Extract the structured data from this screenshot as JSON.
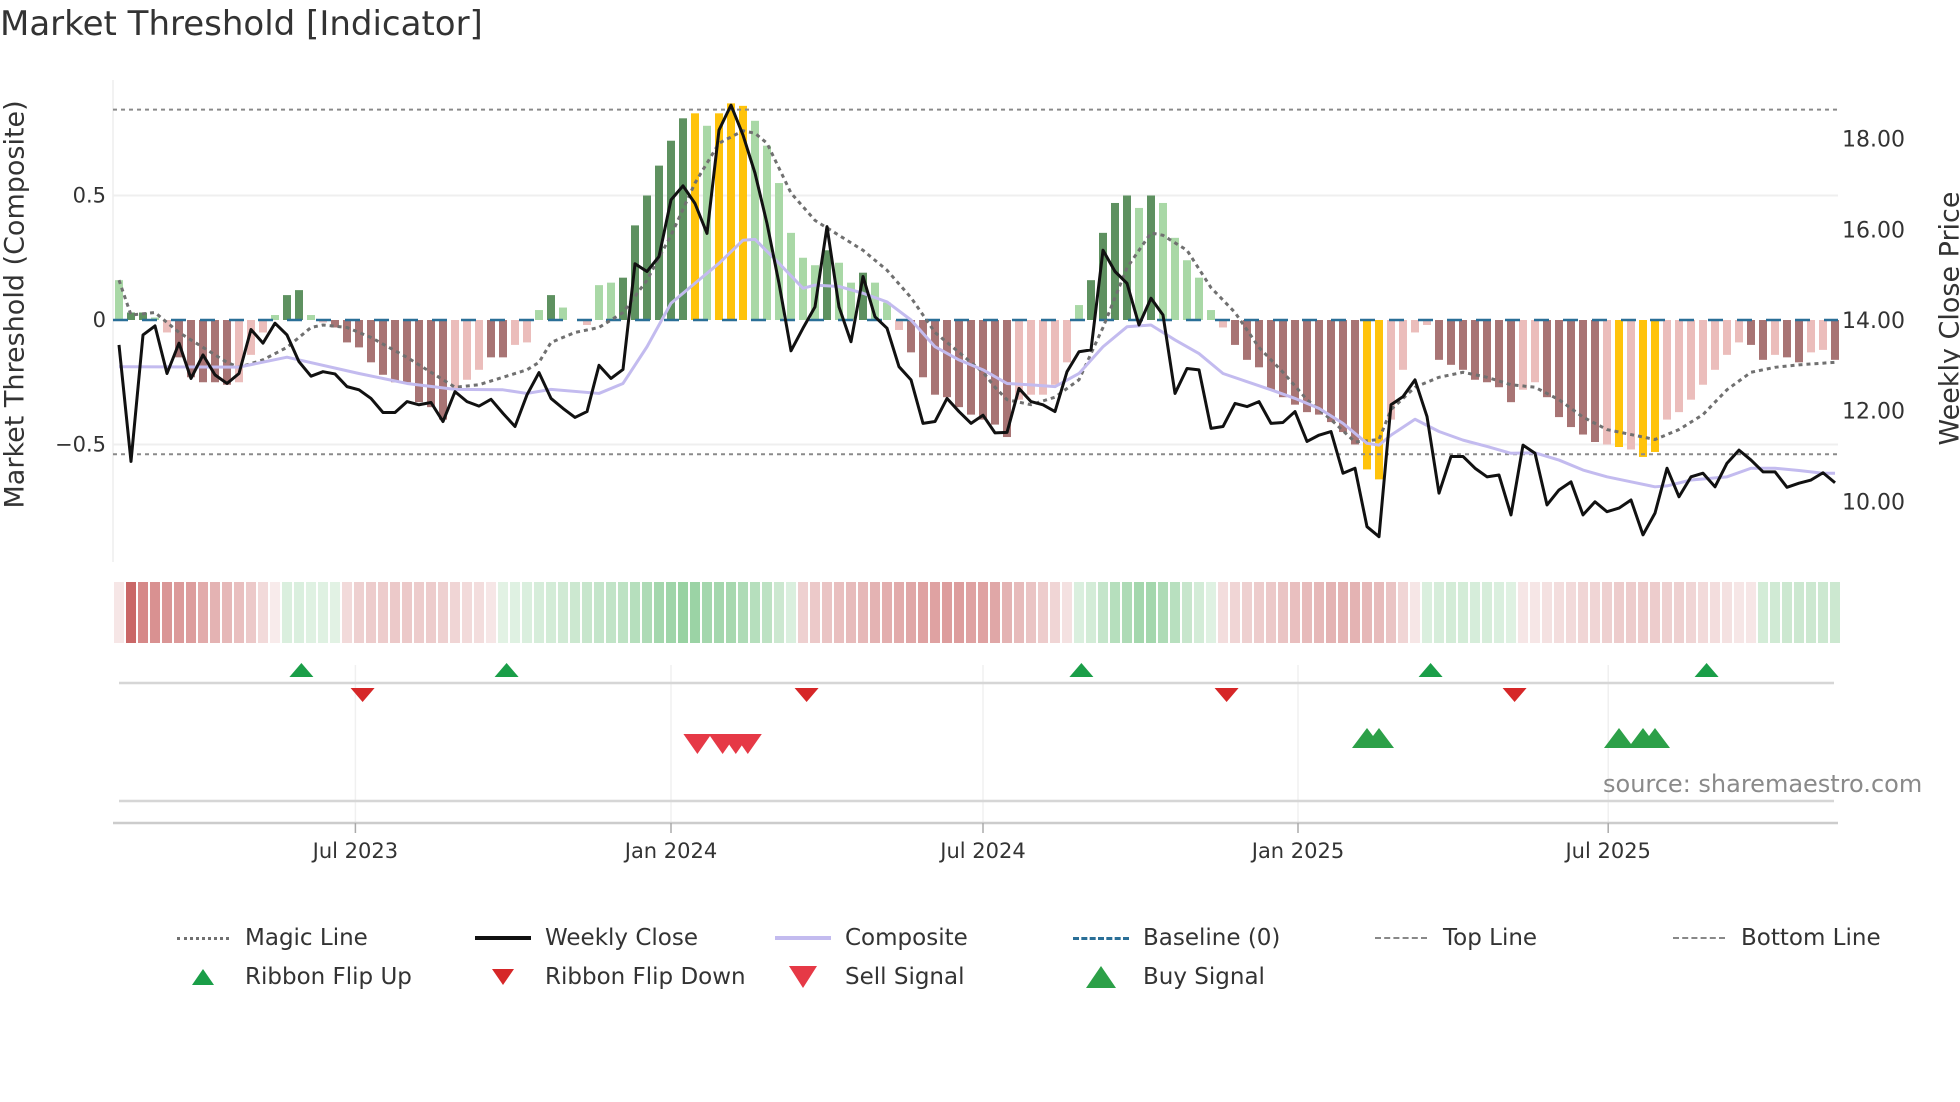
{
  "title": "Market Threshold [Indicator]",
  "source": "source: sharemaestro.com",
  "chart_data": {
    "type": "bar",
    "title": "Market Threshold [Indicator]",
    "ylabel_left": "Market Threshold (Composite)",
    "ylabel_right": "Weekly Close Price",
    "ylim_left": [
      -0.78,
      0.9
    ],
    "ylim_right": [
      8.75,
      19.5
    ],
    "left_ticks": [
      {
        "v": 0.5,
        "label": "0.5"
      },
      {
        "v": 0,
        "label": "0"
      },
      {
        "v": -0.5,
        "label": "−0.5"
      }
    ],
    "right_ticks": [
      {
        "v": 18,
        "label": "18.00"
      },
      {
        "v": 16,
        "label": "16.00"
      },
      {
        "v": 14,
        "label": "14.00"
      },
      {
        "v": 12,
        "label": "12.00"
      },
      {
        "v": 10,
        "label": "10.00"
      }
    ],
    "x_unit": "week index (weekly bars, ~Feb 2023 – Nov 2025)",
    "x_ticks": [
      {
        "week": 19.7,
        "label": "Jul 2023"
      },
      {
        "week": 46,
        "label": "Jan 2024"
      },
      {
        "week": 72,
        "label": "Jul 2024"
      },
      {
        "week": 98.25,
        "label": "Jan 2025"
      },
      {
        "week": 124.1,
        "label": "Jul 2025"
      }
    ],
    "top_line": 0.845,
    "bottom_line": -0.539,
    "baseline": 0,
    "colors": {
      "dg": "#5e9160",
      "lg": "#a9d8a6",
      "dr": "#a87474",
      "lr": "#ebbdbb",
      "y": "#ffc30b",
      "close": "#111111",
      "composite": "#c3bbef",
      "magic": "#707070",
      "baseline": "#2a6f97",
      "flip_up": "#1a9e48",
      "flip_down": "#d62728",
      "sell": "#e63946",
      "buy": "#2ca048"
    },
    "histogram": [
      0.16,
      0.03,
      0.03,
      0.01,
      -0.05,
      -0.15,
      -0.23,
      -0.25,
      -0.25,
      -0.26,
      -0.25,
      -0.14,
      -0.05,
      0.02,
      0.1,
      0.12,
      0.02,
      -0.01,
      -0.03,
      -0.09,
      -0.11,
      -0.17,
      -0.22,
      -0.25,
      -0.25,
      -0.33,
      -0.35,
      -0.4,
      -0.28,
      -0.24,
      -0.2,
      -0.15,
      -0.15,
      -0.1,
      -0.09,
      0.04,
      0.1,
      0.05,
      0.0,
      -0.02,
      0.14,
      0.15,
      0.17,
      0.38,
      0.5,
      0.62,
      0.72,
      0.81,
      0.83,
      0.78,
      0.83,
      0.87,
      0.86,
      0.8,
      0.7,
      0.55,
      0.35,
      0.25,
      0.22,
      0.28,
      0.23,
      0.15,
      0.19,
      0.15,
      0.07,
      -0.04,
      -0.13,
      -0.23,
      -0.3,
      -0.31,
      -0.35,
      -0.38,
      -0.4,
      -0.42,
      -0.47,
      -0.32,
      -0.3,
      -0.3,
      -0.26,
      -0.17,
      0.06,
      0.16,
      0.35,
      0.47,
      0.5,
      0.45,
      0.5,
      0.47,
      0.33,
      0.24,
      0.17,
      0.04,
      -0.03,
      -0.1,
      -0.16,
      -0.19,
      -0.28,
      -0.31,
      -0.34,
      -0.37,
      -0.38,
      -0.41,
      -0.45,
      -0.5,
      -0.6,
      -0.64,
      -0.4,
      -0.2,
      -0.05,
      -0.02,
      -0.16,
      -0.18,
      -0.2,
      -0.24,
      -0.25,
      -0.27,
      -0.33,
      -0.28,
      -0.25,
      -0.31,
      -0.39,
      -0.43,
      -0.46,
      -0.49,
      -0.5,
      -0.51,
      -0.52,
      -0.55,
      -0.53,
      -0.4,
      -0.37,
      -0.32,
      -0.26,
      -0.2,
      -0.14,
      -0.09,
      -0.1,
      -0.16,
      -0.14,
      -0.15,
      -0.17,
      -0.13,
      -0.12,
      -0.16
    ],
    "histogram_color": [
      "lg",
      "dg",
      "dg",
      "lg",
      "lr",
      "dr",
      "dr",
      "dr",
      "dr",
      "dr",
      "lr",
      "lr",
      "lr",
      "lg",
      "dg",
      "dg",
      "lg",
      "lr",
      "dr",
      "dr",
      "dr",
      "dr",
      "dr",
      "dr",
      "dr",
      "dr",
      "dr",
      "dr",
      "lr",
      "lr",
      "lr",
      "dr",
      "dr",
      "lr",
      "lr",
      "lg",
      "dg",
      "lg",
      "lg",
      "lr",
      "lg",
      "lg",
      "dg",
      "dg",
      "dg",
      "dg",
      "dg",
      "dg",
      "y",
      "lg",
      "y",
      "y",
      "y",
      "lg",
      "lg",
      "lg",
      "lg",
      "lg",
      "lg",
      "dg",
      "lg",
      "lg",
      "dg",
      "lg",
      "lg",
      "lr",
      "dr",
      "dr",
      "dr",
      "dr",
      "dr",
      "dr",
      "dr",
      "dr",
      "dr",
      "lr",
      "lr",
      "lr",
      "lr",
      "lr",
      "lg",
      "dg",
      "dg",
      "dg",
      "dg",
      "lg",
      "dg",
      "lg",
      "lg",
      "lg",
      "lg",
      "lg",
      "lr",
      "dr",
      "dr",
      "dr",
      "dr",
      "dr",
      "dr",
      "dr",
      "dr",
      "dr",
      "dr",
      "dr",
      "y",
      "y",
      "lr",
      "lr",
      "lr",
      "lr",
      "dr",
      "dr",
      "dr",
      "dr",
      "dr",
      "dr",
      "dr",
      "lr",
      "lr",
      "dr",
      "dr",
      "dr",
      "dr",
      "dr",
      "lr",
      "y",
      "lr",
      "y",
      "y",
      "lr",
      "lr",
      "lr",
      "lr",
      "lr",
      "lr",
      "lr",
      "dr",
      "dr",
      "lr",
      "dr",
      "dr",
      "lr",
      "lr",
      "dr"
    ],
    "weekly_close": [
      13.45,
      10.88,
      13.67,
      13.87,
      12.82,
      13.49,
      12.71,
      13.23,
      12.79,
      12.6,
      12.82,
      13.79,
      13.49,
      13.93,
      13.67,
      13.08,
      12.76,
      12.86,
      12.81,
      12.53,
      12.46,
      12.27,
      11.96,
      11.96,
      12.2,
      12.13,
      12.18,
      11.76,
      12.42,
      12.2,
      12.1,
      12.25,
      11.94,
      11.65,
      12.35,
      12.84,
      12.27,
      12.05,
      11.85,
      11.98,
      13.0,
      12.71,
      12.91,
      15.24,
      15.07,
      15.4,
      16.65,
      16.96,
      16.57,
      15.91,
      18.19,
      18.74,
      18.08,
      17.24,
      16.13,
      14.81,
      13.32,
      13.82,
      14.29,
      16.06,
      14.29,
      13.52,
      14.96,
      14.07,
      13.82,
      12.97,
      12.68,
      11.72,
      11.76,
      12.27,
      11.98,
      11.72,
      11.9,
      11.51,
      11.52,
      12.49,
      12.2,
      12.13,
      11.98,
      12.86,
      13.3,
      13.34,
      15.54,
      15.07,
      14.81,
      13.89,
      14.48,
      14.11,
      12.38,
      12.93,
      12.9,
      11.61,
      11.65,
      12.16,
      12.09,
      12.2,
      11.72,
      11.74,
      11.98,
      11.32,
      11.46,
      11.54,
      10.62,
      10.73,
      9.44,
      9.22,
      12.13,
      12.31,
      12.68,
      11.87,
      10.18,
      10.99,
      10.99,
      10.73,
      10.54,
      10.58,
      9.7,
      11.24,
      11.06,
      9.92,
      10.25,
      10.43,
      9.7,
      9.99,
      9.77,
      9.85,
      10.03,
      9.26,
      9.74,
      10.73,
      10.1,
      10.54,
      10.62,
      10.32,
      10.84,
      11.13,
      10.91,
      10.65,
      10.65,
      10.31,
      10.4,
      10.47,
      10.63,
      10.41
    ],
    "composite": [
      [
        0,
        12.97
      ],
      [
        10,
        12.96
      ],
      [
        14,
        13.18
      ],
      [
        20,
        12.82
      ],
      [
        24,
        12.6
      ],
      [
        28,
        12.47
      ],
      [
        32,
        12.46
      ],
      [
        34,
        12.38
      ],
      [
        36,
        12.47
      ],
      [
        40,
        12.38
      ],
      [
        42,
        12.6
      ],
      [
        44,
        13.41
      ],
      [
        46,
        14.37
      ],
      [
        48,
        14.81
      ],
      [
        50,
        15.25
      ],
      [
        52,
        15.76
      ],
      [
        53,
        15.78
      ],
      [
        55,
        15.25
      ],
      [
        57,
        14.7
      ],
      [
        58,
        14.77
      ],
      [
        60,
        14.74
      ],
      [
        62,
        14.59
      ],
      [
        64,
        14.4
      ],
      [
        66,
        14.0
      ],
      [
        68,
        13.41
      ],
      [
        70,
        13.12
      ],
      [
        72,
        12.9
      ],
      [
        74,
        12.6
      ],
      [
        76,
        12.57
      ],
      [
        78,
        12.53
      ],
      [
        80,
        12.82
      ],
      [
        82,
        13.41
      ],
      [
        84,
        13.85
      ],
      [
        86,
        13.89
      ],
      [
        88,
        13.56
      ],
      [
        90,
        13.26
      ],
      [
        92,
        12.82
      ],
      [
        94,
        12.64
      ],
      [
        96,
        12.46
      ],
      [
        98,
        12.27
      ],
      [
        100,
        12.05
      ],
      [
        102,
        11.72
      ],
      [
        104,
        11.28
      ],
      [
        105,
        11.24
      ],
      [
        106,
        11.46
      ],
      [
        108,
        11.81
      ],
      [
        110,
        11.54
      ],
      [
        112,
        11.35
      ],
      [
        114,
        11.21
      ],
      [
        116,
        11.06
      ],
      [
        118,
        11.07
      ],
      [
        120,
        10.91
      ],
      [
        122,
        10.69
      ],
      [
        124,
        10.54
      ],
      [
        126,
        10.43
      ],
      [
        128,
        10.32
      ],
      [
        129,
        10.34
      ],
      [
        131,
        10.47
      ],
      [
        134,
        10.54
      ],
      [
        136,
        10.73
      ],
      [
        138,
        10.73
      ],
      [
        140,
        10.68
      ],
      [
        142,
        10.62
      ],
      [
        143,
        10.62
      ]
    ],
    "magic_line": [
      [
        0,
        0.16
      ],
      [
        1,
        0.02
      ],
      [
        3,
        0.03
      ],
      [
        5,
        -0.05
      ],
      [
        7,
        -0.11
      ],
      [
        9,
        -0.17
      ],
      [
        10,
        -0.19
      ],
      [
        12,
        -0.16
      ],
      [
        14,
        -0.11
      ],
      [
        16,
        -0.03
      ],
      [
        17,
        -0.02
      ],
      [
        19,
        -0.03
      ],
      [
        21,
        -0.07
      ],
      [
        24,
        -0.15
      ],
      [
        27,
        -0.24
      ],
      [
        28,
        -0.27
      ],
      [
        30,
        -0.26
      ],
      [
        32,
        -0.23
      ],
      [
        34,
        -0.2
      ],
      [
        35,
        -0.17
      ],
      [
        36,
        -0.09
      ],
      [
        38,
        -0.05
      ],
      [
        40,
        -0.03
      ],
      [
        42,
        0.03
      ],
      [
        44,
        0.16
      ],
      [
        46,
        0.34
      ],
      [
        48,
        0.55
      ],
      [
        50,
        0.71
      ],
      [
        52,
        0.76
      ],
      [
        53,
        0.75
      ],
      [
        54,
        0.71
      ],
      [
        56,
        0.51
      ],
      [
        58,
        0.4
      ],
      [
        60,
        0.34
      ],
      [
        62,
        0.28
      ],
      [
        64,
        0.2
      ],
      [
        66,
        0.09
      ],
      [
        68,
        -0.05
      ],
      [
        70,
        -0.13
      ],
      [
        72,
        -0.21
      ],
      [
        73,
        -0.27
      ],
      [
        74,
        -0.32
      ],
      [
        76,
        -0.34
      ],
      [
        78,
        -0.31
      ],
      [
        80,
        -0.24
      ],
      [
        82,
        -0.03
      ],
      [
        84,
        0.21
      ],
      [
        86,
        0.35
      ],
      [
        87,
        0.34
      ],
      [
        89,
        0.28
      ],
      [
        91,
        0.13
      ],
      [
        93,
        0.03
      ],
      [
        95,
        -0.11
      ],
      [
        97,
        -0.21
      ],
      [
        99,
        -0.32
      ],
      [
        101,
        -0.4
      ],
      [
        103,
        -0.49
      ],
      [
        105,
        -0.48
      ],
      [
        106,
        -0.36
      ],
      [
        108,
        -0.27
      ],
      [
        110,
        -0.23
      ],
      [
        112,
        -0.21
      ],
      [
        114,
        -0.23
      ],
      [
        116,
        -0.26
      ],
      [
        118,
        -0.27
      ],
      [
        120,
        -0.32
      ],
      [
        122,
        -0.39
      ],
      [
        124,
        -0.44
      ],
      [
        126,
        -0.46
      ],
      [
        128,
        -0.48
      ],
      [
        130,
        -0.44
      ],
      [
        132,
        -0.38
      ],
      [
        134,
        -0.28
      ],
      [
        136,
        -0.21
      ],
      [
        138,
        -0.19
      ],
      [
        140,
        -0.18
      ],
      [
        143,
        -0.17
      ]
    ],
    "ribbon": [
      -0.15,
      -0.9,
      -0.7,
      -0.65,
      -0.62,
      -0.6,
      -0.58,
      -0.5,
      -0.45,
      -0.42,
      -0.38,
      -0.32,
      -0.22,
      -0.12,
      0.25,
      0.25,
      0.22,
      0.22,
      0.2,
      -0.22,
      -0.28,
      -0.3,
      -0.3,
      -0.32,
      -0.32,
      -0.3,
      -0.3,
      -0.28,
      -0.25,
      -0.22,
      -0.2,
      -0.15,
      0.2,
      0.22,
      0.25,
      0.28,
      0.3,
      0.32,
      0.35,
      0.38,
      0.4,
      0.42,
      0.45,
      0.5,
      0.55,
      0.62,
      0.65,
      0.7,
      0.68,
      0.62,
      0.62,
      0.6,
      0.55,
      0.5,
      0.45,
      0.35,
      0.25,
      -0.28,
      -0.32,
      -0.35,
      -0.38,
      -0.4,
      -0.42,
      -0.45,
      -0.48,
      -0.5,
      -0.52,
      -0.55,
      -0.55,
      -0.58,
      -0.58,
      -0.55,
      -0.55,
      -0.52,
      -0.45,
      -0.4,
      -0.35,
      -0.3,
      -0.25,
      -0.18,
      0.25,
      0.3,
      0.4,
      0.5,
      0.55,
      0.62,
      0.62,
      0.55,
      0.48,
      0.38,
      0.3,
      0.22,
      -0.2,
      -0.25,
      -0.28,
      -0.3,
      -0.32,
      -0.35,
      -0.38,
      -0.4,
      -0.42,
      -0.45,
      -0.45,
      -0.45,
      -0.42,
      -0.4,
      -0.35,
      -0.25,
      -0.15,
      0.25,
      0.28,
      0.3,
      0.3,
      0.28,
      0.28,
      0.25,
      0.22,
      -0.15,
      -0.15,
      -0.18,
      -0.2,
      -0.22,
      -0.25,
      -0.25,
      -0.28,
      -0.3,
      -0.3,
      -0.3,
      -0.3,
      -0.28,
      -0.28,
      -0.25,
      -0.22,
      -0.2,
      -0.18,
      -0.15,
      -0.15,
      0.3,
      0.32,
      0.35,
      0.35,
      0.35,
      0.35,
      0.35
    ],
    "ribbon_flip_up": [
      15.2,
      32.3,
      80.2,
      109.3,
      132.3
    ],
    "ribbon_flip_down": [
      20.3,
      57.3,
      92.3,
      116.3
    ],
    "sell_signals": [
      48.2,
      50.3,
      51.4,
      52.4
    ],
    "buy_signals": [
      104,
      105,
      125,
      127,
      128
    ]
  },
  "legend": [
    {
      "label": "Magic Line",
      "handle": "dotted-line"
    },
    {
      "label": "Weekly Close",
      "handle": "solid-line"
    },
    {
      "label": "Composite",
      "handle": "lavender-line"
    },
    {
      "label": "Baseline (0)",
      "handle": "dashed-line"
    },
    {
      "label": "Top Line",
      "handle": "grey-dashed-line"
    },
    {
      "label": "Bottom Line",
      "handle": "grey-dashed-line"
    },
    {
      "label": "Ribbon Flip Up",
      "handle": "triangle-up-icon"
    },
    {
      "label": "Ribbon Flip Down",
      "handle": "triangle-down-icon"
    },
    {
      "label": "Sell Signal",
      "handle": "sell-triangle-icon"
    },
    {
      "label": "Buy Signal",
      "handle": "buy-triangle-icon"
    }
  ]
}
